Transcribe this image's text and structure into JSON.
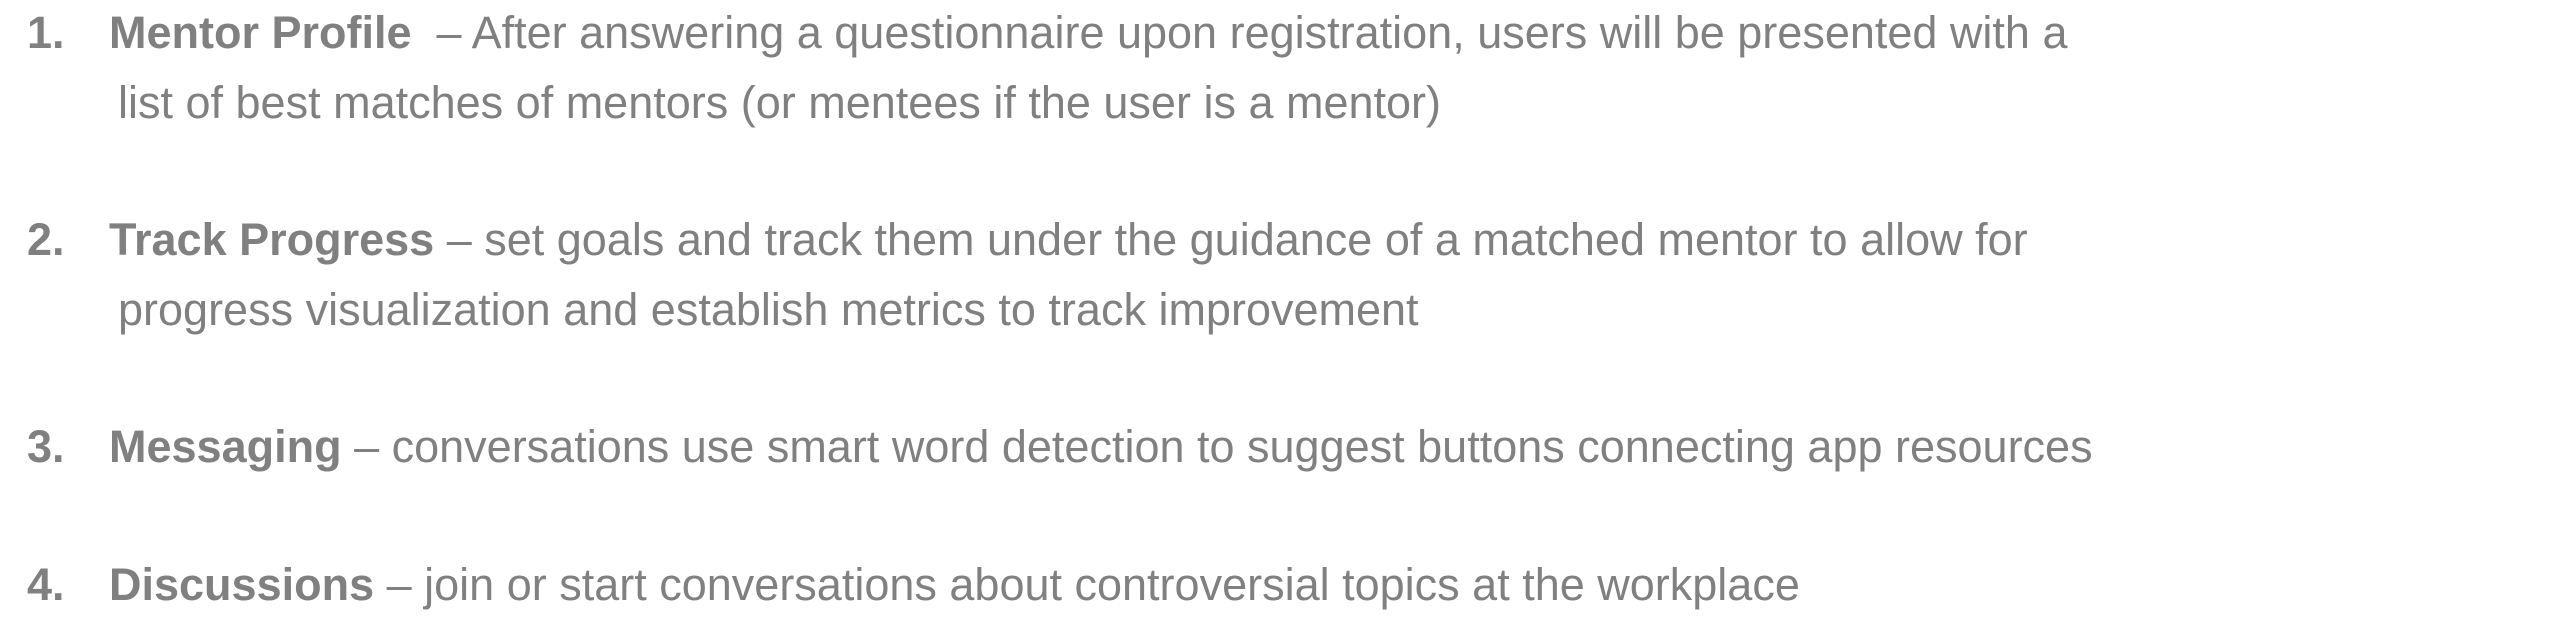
{
  "items": [
    {
      "number": "1.",
      "label": "Mentor Profile",
      "sep": "  – ",
      "line1": "After answering a questionnaire upon registration, users will be presented with a",
      "line2": "list of best matches of mentors (or mentees if the user is a mentor)"
    },
    {
      "number": "2.",
      "label": "Track Progress",
      "sep": " – ",
      "line1": "set goals and track them under the guidance of a matched mentor to allow for",
      "line2": "progress visualization and establish metrics to track improvement"
    },
    {
      "number": "3.",
      "label": "Messaging",
      "sep": " – ",
      "line1": "conversations use smart word detection to suggest buttons connecting app resources"
    },
    {
      "number": "4.",
      "label": "Discussions",
      "sep": " – ",
      "line1": "join or start conversations about controversial topics at the workplace"
    }
  ],
  "colors": {
    "text": "#808080",
    "background": "#ffffff"
  }
}
